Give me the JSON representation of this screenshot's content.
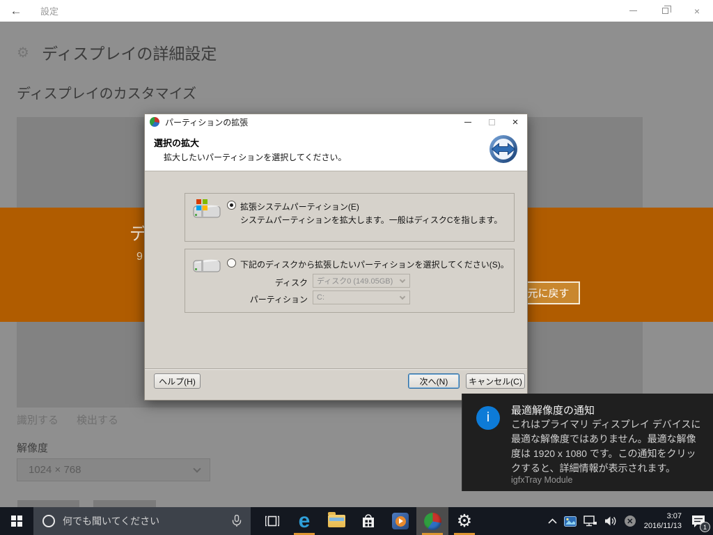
{
  "colors": {
    "banner_orange": "#b05c00",
    "revert_button_orange": "#c9872e",
    "toast_icon_blue": "#0d7bd7",
    "taskbar_underline_orange": "#dc9631"
  },
  "icons": {
    "back": "←",
    "close": "×",
    "gear": "⚙",
    "edge_letter": "e"
  },
  "settings": {
    "titlebar": {
      "title": "設定"
    },
    "heading": "ディスプレイの詳細設定",
    "subheading": "ディスプレイのカスタマイズ",
    "banner": {
      "text_fragment_1": "デ",
      "text_fragment_2": "9",
      "revert_button": "元に戻す"
    },
    "identify_link": "識別する",
    "detect_link": "検出する",
    "resolution_label": "解像度",
    "resolution_value": "1024 × 768"
  },
  "dialog": {
    "title": "パーティションの拡張",
    "header_title": "選択の拡大",
    "header_subtitle": "拡大したいパーティションを選択してください。",
    "option_system": {
      "label": "拡張システムパーティション(E)",
      "description": "システムパーティションを拡大します。一般はディスクCを指します。"
    },
    "option_manual": {
      "label": "下記のディスクから拡張したいパーティションを選択してください(S)。",
      "disk_label": "ディスク",
      "disk_value": "ディスク0 (149.05GB)",
      "partition_label": "パーティション",
      "partition_value": "C:"
    },
    "help_button": "ヘルプ(H)",
    "next_button": "次へ(N)",
    "cancel_button": "キャンセル(C)"
  },
  "toast": {
    "icon_letter": "i",
    "title": "最適解像度の通知",
    "body": "これはプライマリ ディスプレイ デバイスに最適な解像度ではありません。最適な解像度は 1920 x 1080 です。この通知をクリックすると、詳細情報が表示されます。",
    "source": "igfxTray Module"
  },
  "taskbar": {
    "search_placeholder": "何でも聞いてください",
    "time": "3:07",
    "date": "2016/11/13",
    "notification_badge": "1"
  }
}
